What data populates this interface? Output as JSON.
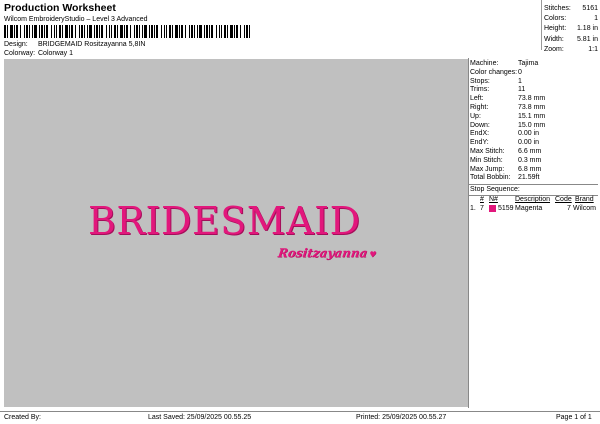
{
  "header": {
    "title": "Production Worksheet",
    "subtitle": "Wilcom EmbroideryStudio – Level 3 Advanced",
    "design_label": "Design:",
    "design_value": "BRIDGEMAID Rositzayanna 5,8IN",
    "colorway_label": "Colorway:",
    "colorway_value": "Colorway 1"
  },
  "stats": [
    {
      "label": "Stitches:",
      "value": "5161"
    },
    {
      "label": "Colors:",
      "value": "1"
    },
    {
      "label": "Height:",
      "value": "1.18 in"
    },
    {
      "label": "Width:",
      "value": "5.81 in"
    },
    {
      "label": "Zoom:",
      "value": "1:1"
    }
  ],
  "design": {
    "main_text": "BRIDESMAID",
    "script_text": "Rositzayanna",
    "heart": "♥",
    "thread_color": "#e2177c",
    "canvas_color": "#c0c0c0"
  },
  "properties": [
    {
      "label": "Machine:",
      "value": "Tajima"
    },
    {
      "label": "Color changes:",
      "value": "0"
    },
    {
      "label": "Stops:",
      "value": "1"
    },
    {
      "label": "Trims:",
      "value": "11"
    },
    {
      "label": "Left:",
      "value": "73.8 mm"
    },
    {
      "label": "Right:",
      "value": "73.8 mm"
    },
    {
      "label": "Up:",
      "value": "15.1 mm"
    },
    {
      "label": "Down:",
      "value": "15.0 mm"
    },
    {
      "label": "EndX:",
      "value": "0.00 in"
    },
    {
      "label": "EndY:",
      "value": "0.00 in"
    },
    {
      "label": "Max Stitch:",
      "value": "6.6 mm"
    },
    {
      "label": "Min Stitch:",
      "value": "0.3 mm"
    },
    {
      "label": "Max Jump:",
      "value": "6.8 mm"
    },
    {
      "label": "Total Bobbin:",
      "value": "21.59ft"
    }
  ],
  "stop_sequence": {
    "title": "Stop Sequence:",
    "headers": [
      "#",
      "N#",
      "Description",
      "Code",
      "Brand"
    ],
    "row": {
      "index": "1.",
      "stop": "7",
      "n": "5159",
      "description": "Magenta",
      "code": "7",
      "brand": "Wilcom"
    }
  },
  "footer": {
    "created_by": "Created By:",
    "last_saved": "Last Saved: 25/09/2025 00.55.25",
    "printed": "Printed: 25/09/2025 00.55.27",
    "page": "Page 1 of 1"
  }
}
